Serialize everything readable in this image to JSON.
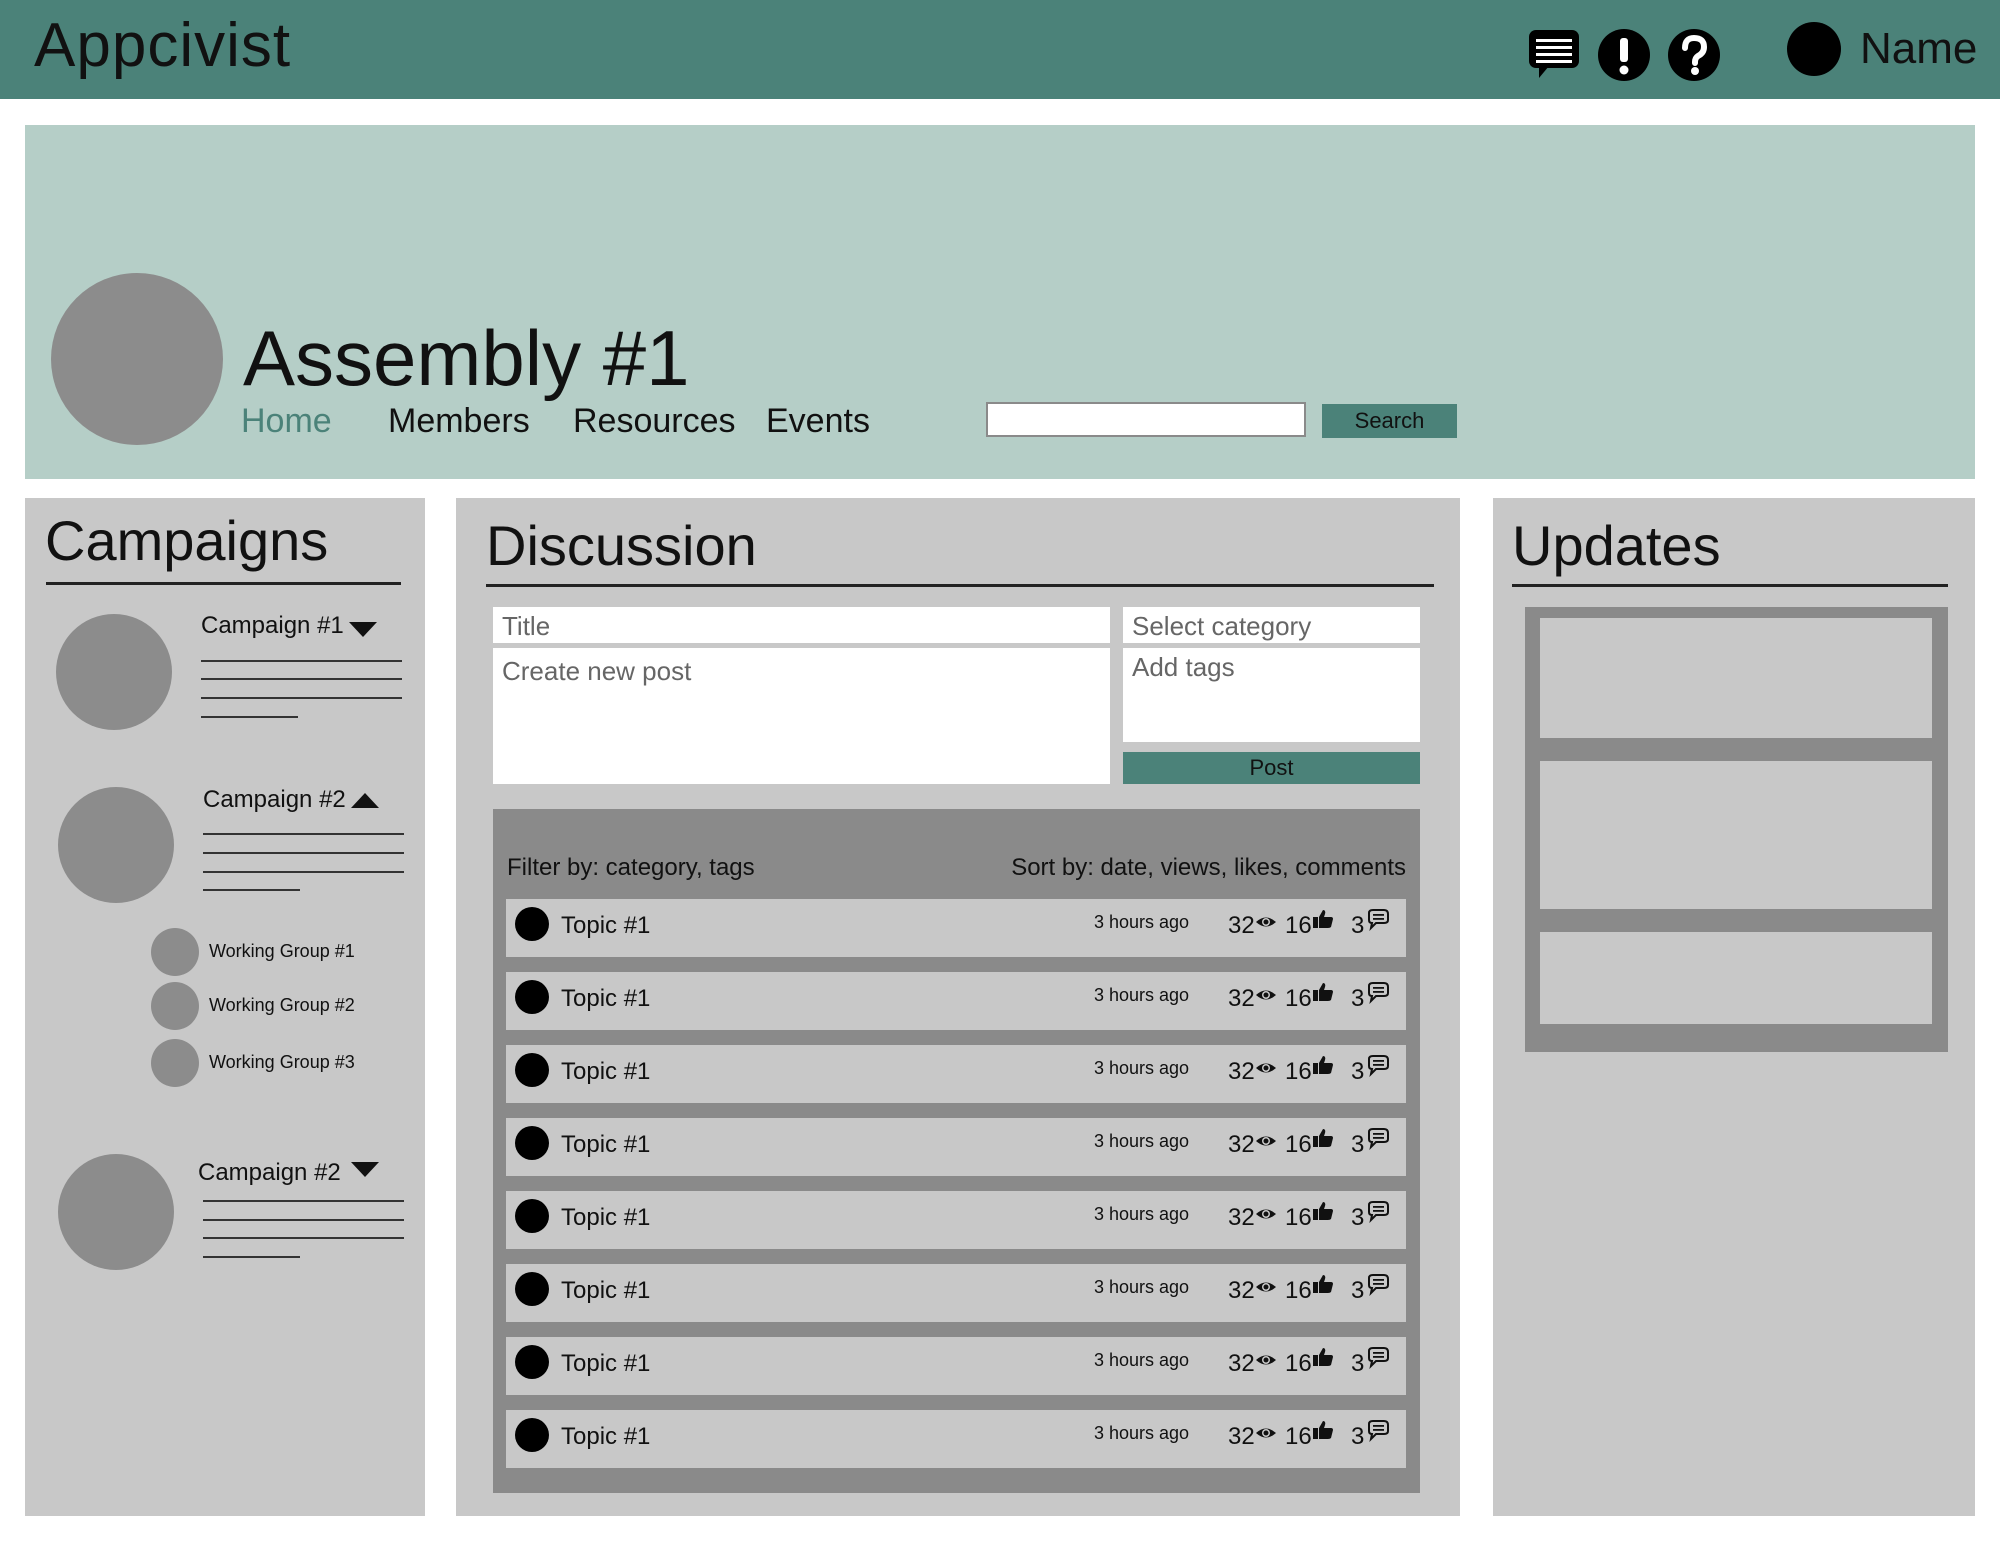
{
  "app": {
    "title": "Appcivist"
  },
  "header": {
    "icons": [
      "chat-icon",
      "alert-icon",
      "help-icon"
    ],
    "user_name": "Name"
  },
  "assembly": {
    "title": "Assembly #1",
    "nav": [
      "Home",
      "Members",
      "Resources",
      "Events"
    ],
    "active_nav": "Home",
    "search_value": "",
    "search_label": "Search"
  },
  "campaigns": {
    "title": "Campaigns",
    "items": [
      {
        "label": "Campaign #1",
        "expanded": false
      },
      {
        "label": "Campaign #2",
        "expanded": true,
        "working_groups": [
          "Working Group #1",
          "Working Group #2",
          "Working Group #3"
        ]
      },
      {
        "label": "Campaign #2",
        "expanded": false
      }
    ]
  },
  "discussion": {
    "title": "Discussion",
    "title_placeholder": "Title",
    "category_placeholder": "Select category",
    "post_placeholder": "Create new post",
    "tags_placeholder": "Add tags",
    "post_label": "Post",
    "filter_label": "Filter by: category, tags",
    "sort_label": "Sort by: date, views, likes, comments",
    "topics": [
      {
        "title": "Topic #1",
        "time": "3 hours ago",
        "views": "32",
        "likes": "16",
        "comments": "3"
      },
      {
        "title": "Topic #1",
        "time": "3 hours ago",
        "views": "32",
        "likes": "16",
        "comments": "3"
      },
      {
        "title": "Topic #1",
        "time": "3 hours ago",
        "views": "32",
        "likes": "16",
        "comments": "3"
      },
      {
        "title": "Topic #1",
        "time": "3 hours ago",
        "views": "32",
        "likes": "16",
        "comments": "3"
      },
      {
        "title": "Topic #1",
        "time": "3 hours ago",
        "views": "32",
        "likes": "16",
        "comments": "3"
      },
      {
        "title": "Topic #1",
        "time": "3 hours ago",
        "views": "32",
        "likes": "16",
        "comments": "3"
      },
      {
        "title": "Topic #1",
        "time": "3 hours ago",
        "views": "32",
        "likes": "16",
        "comments": "3"
      },
      {
        "title": "Topic #1",
        "time": "3 hours ago",
        "views": "32",
        "likes": "16",
        "comments": "3"
      }
    ]
  },
  "updates": {
    "title": "Updates"
  },
  "colors": {
    "primary": "#4b8279",
    "banner": "#b5cec7",
    "panel": "#c8c8c8",
    "placeholder_gray": "#8c8c8c"
  }
}
